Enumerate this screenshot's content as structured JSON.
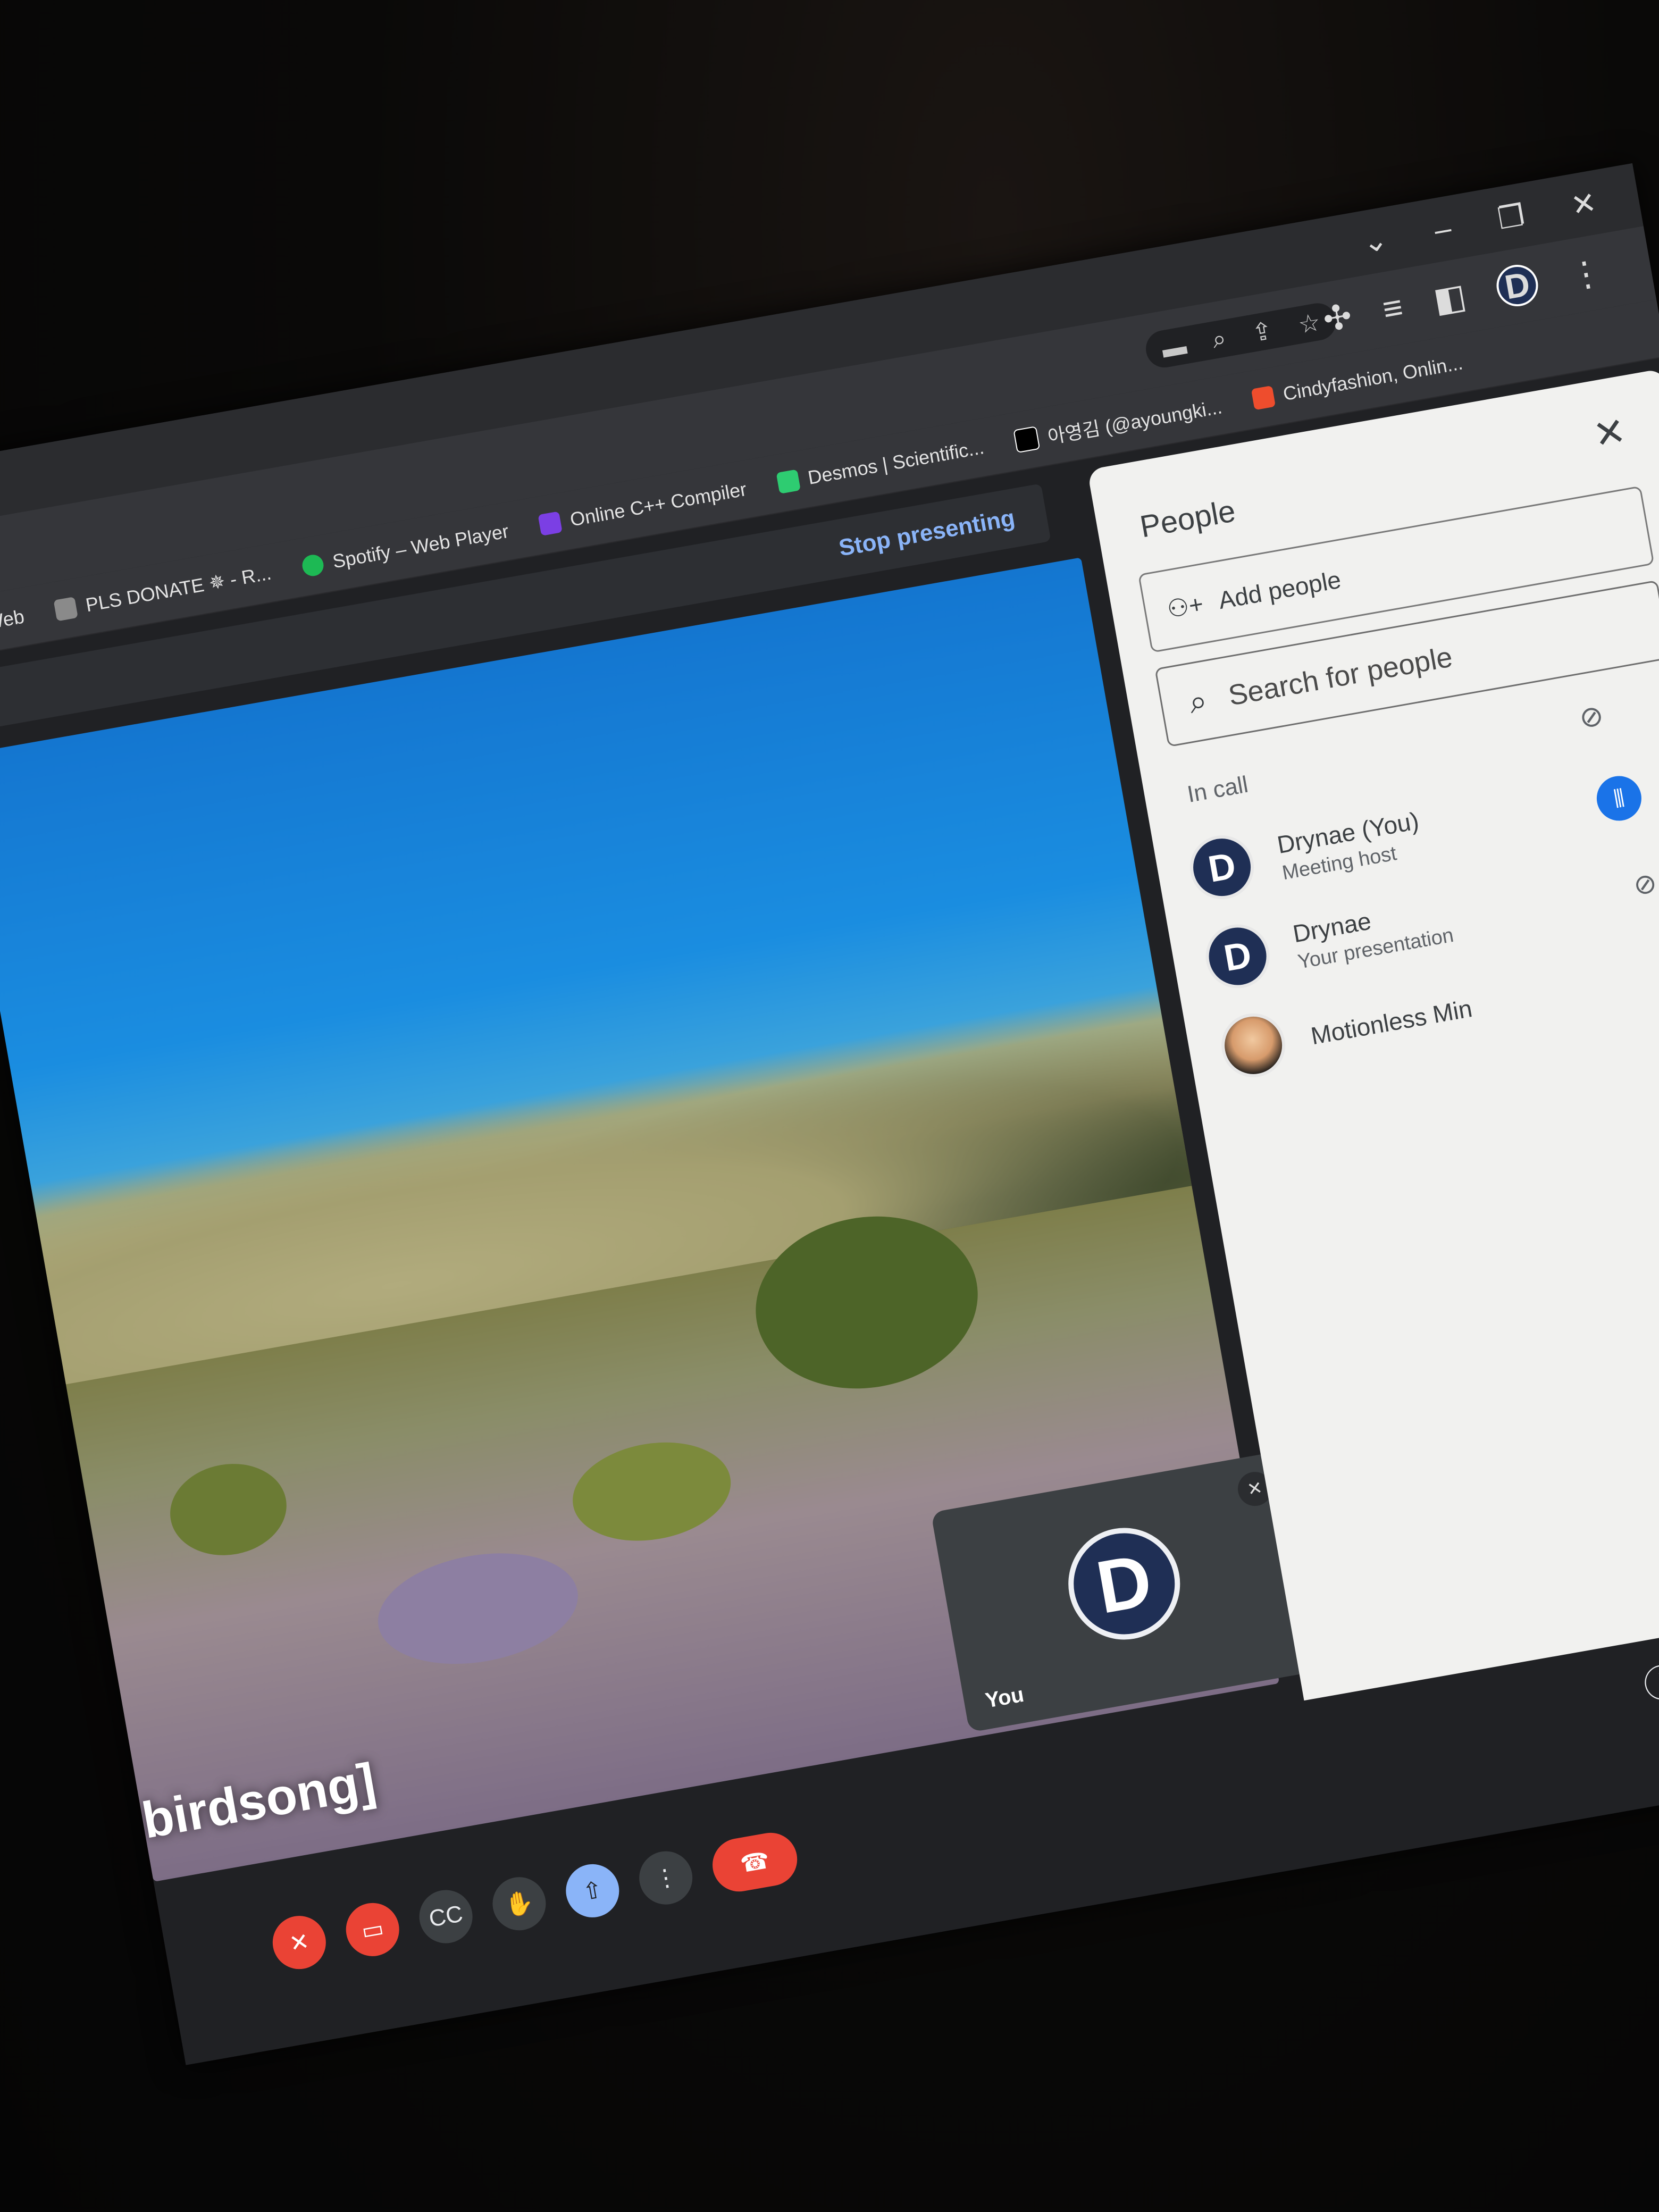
{
  "browser": {
    "window_controls": [
      "⌄",
      "–",
      "❐",
      "✕"
    ],
    "omnibox_icons": [
      "camera-icon",
      "search-icon",
      "share-icon",
      "star-icon"
    ],
    "toolbar_icons": [
      "puzzle-icon",
      "playlist-icon",
      "sidepanel-icon",
      "profile-avatar",
      "more-icon"
    ],
    "profile_initial": "D",
    "bookmarks": [
      {
        "label": "ent Web",
        "color": "#3c4043"
      },
      {
        "label": "PLS DONATE ✵ - R...",
        "color": "#8a8a8a"
      },
      {
        "label": "Spotify – Web Player",
        "color": "#1db954"
      },
      {
        "label": "Online C++ Compiler",
        "color": "#7b3fe4"
      },
      {
        "label": "Desmos | Scientific...",
        "color": "#2ecc71"
      },
      {
        "label": "아영김 (@ayoungki...",
        "color": "#000000"
      },
      {
        "label": "Cindyfashion, Onlin...",
        "color": "#ee4d2d"
      }
    ]
  },
  "meet": {
    "stop_presenting": "Stop presenting",
    "caption": "birdsong]",
    "self_tile": {
      "label": "You",
      "initial": "D"
    },
    "controls": [
      "mic-off",
      "camera-off",
      "captions",
      "raise-hand",
      "present",
      "more",
      "end-call"
    ],
    "participant_count": "3"
  },
  "people_panel": {
    "title": "People",
    "add_people": "Add people",
    "search_placeholder": "Search for people",
    "section_label": "In call",
    "participants": [
      {
        "name": "Drynae (You)",
        "subtitle": "Meeting host",
        "initial": "D"
      },
      {
        "name": "Drynae",
        "subtitle": "Your presentation",
        "initial": "D"
      },
      {
        "name": "Motionless Min",
        "subtitle": "",
        "initial": ""
      }
    ]
  }
}
